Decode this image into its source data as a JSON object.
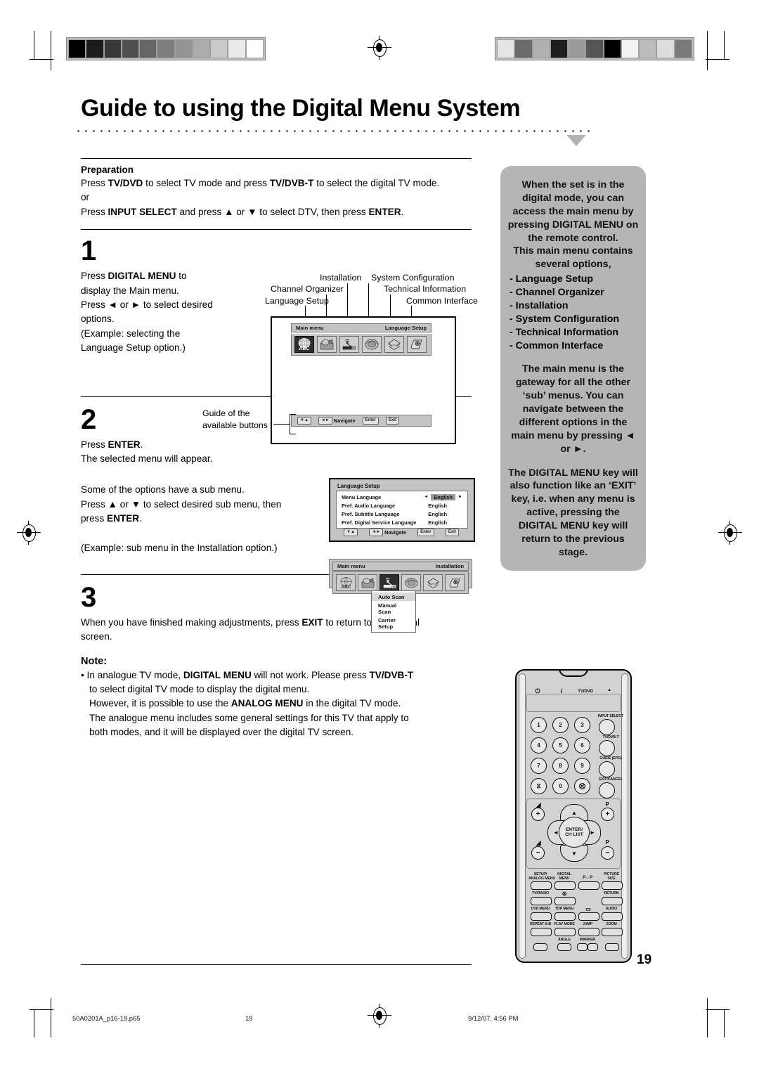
{
  "page": {
    "title": "Guide to using the Digital Menu System",
    "number": "19"
  },
  "preparation": {
    "heading": "Preparation",
    "line1_a": "Press ",
    "line1_b": "TV/DVD",
    "line1_c": " to select TV mode and press ",
    "line1_d": "TV/DVB-T",
    "line1_e": " to select the digital TV mode.",
    "or": "or",
    "line2_a": "Press ",
    "line2_b": "INPUT SELECT",
    "line2_c": " and press ▲ or ▼ to select DTV, then press ",
    "line2_d": "ENTER",
    "line2_e": "."
  },
  "steps": {
    "one": {
      "number": "1",
      "l1_a": "Press ",
      "l1_b": "DIGITAL MENU",
      "l1_c": " to",
      "l2": "display the Main menu.",
      "l3": "Press ◄ or ► to select desired",
      "l4": "options.",
      "l5": "(Example: selecting the",
      "l6": "Language Setup option.)"
    },
    "two": {
      "number": "2",
      "l1_a": "Press ",
      "l1_b": "ENTER",
      "l1_c": ".",
      "l2": "The selected menu will appear.",
      "l3": "Some of the options have a sub menu.",
      "l4_a": "Press ▲ or ▼ to select desired sub menu, then",
      "l4_b": "press ",
      "l4_c": "ENTER",
      "l4_d": ".",
      "l5": "(Example: sub menu in the Installation option.)"
    },
    "three": {
      "number": "3",
      "l1_a": "When you have finished making adjustments, press ",
      "l1_b": "EXIT",
      "l1_c": " to return to the normal",
      "l2": "screen."
    }
  },
  "note": {
    "heading": "Note:",
    "bullet": "•",
    "b1_a": "In analogue TV mode, ",
    "b1_b": "DIGITAL MENU",
    "b1_c": " will not work. Please press ",
    "b1_d": "TV/DVB-T",
    "b2": "to select digital TV mode to display the digital menu.",
    "b3_a": "However, it is possible to use the ",
    "b3_b": "ANALOG MENU",
    "b3_c": " in the digital TV mode.",
    "b4": "The analogue menu includes some general settings for this TV that apply to",
    "b5": "both modes, and it will be displayed over the digital TV screen."
  },
  "callouts": {
    "language_setup": "Language Setup",
    "channel_organizer": "Channel Organizer",
    "installation": "Installation",
    "system_configuration": "System Configuration",
    "technical_information": "Technical Information",
    "common_interface": "Common Interface",
    "guide_line1": "Guide of the",
    "guide_line2": "available buttons"
  },
  "osd_main": {
    "title_left": "Main menu",
    "title_right": "Language Setup",
    "icons": [
      {
        "name": "language-setup-icon",
        "glyph": "AʙC",
        "selected": true
      },
      {
        "name": "channel-organizer-icon",
        "glyph": "",
        "selected": false
      },
      {
        "name": "installation-icon",
        "glyph": "",
        "selected": false
      },
      {
        "name": "system-configuration-icon",
        "glyph": "",
        "selected": false
      },
      {
        "name": "technical-information-icon",
        "glyph": "",
        "selected": false
      },
      {
        "name": "common-interface-icon",
        "glyph": "",
        "selected": false
      }
    ],
    "guide": {
      "updown": "▼▲",
      "leftright": "◄►",
      "navigate": "Navigate",
      "enter": "Enter",
      "exit": "Exit"
    }
  },
  "osd_language": {
    "title": "Language Setup",
    "rows": [
      {
        "label": "Menu Language",
        "value": "English",
        "selected": true
      },
      {
        "label": "Pref. Audio Language",
        "value": "English",
        "selected": false
      },
      {
        "label": "Pref. Subtitle Language",
        "value": "English",
        "selected": false
      },
      {
        "label": "Pref. Digital Service Language",
        "value": "English",
        "selected": false
      }
    ],
    "arrow_left": "◄",
    "arrow_right": "►"
  },
  "osd_installation": {
    "title_left": "Main menu",
    "title_right": "Installation",
    "submenu": [
      "Auto Scan",
      "Manual Scan",
      "Carrier Setup"
    ]
  },
  "panel": {
    "p1": "When the set is in the digital mode, you can access the main menu by pressing DIGITAL MENU on the remote control.",
    "p2": "This main menu contains several options,",
    "bullets": [
      "- Language Setup",
      "- Channel Organizer",
      "- Installation",
      "- System Configuration",
      "- Technical Information",
      "- Common Interface"
    ],
    "p3": "The main menu is the gateway for all the other ‘sub’ menus. You can navigate between the different options in the main menu by pressing ◄ or ►.",
    "p4": "The DIGITAL MENU key will also function like an ‘EXIT’ key, i.e. when any menu is active, pressing the DIGITAL MENU key will return to the previous stage."
  },
  "remote": {
    "power": "⏻",
    "info": "i",
    "tv_dvd": "TV/DVD",
    "eject": "▲",
    "input_select": "INPUT SELECT",
    "tv_dvbt": "TV/DVB-T",
    "guide_epg": "GUIDE (EPG)",
    "exit_cancel": "EXIT/CANCEL",
    "numbers": [
      "1",
      "2",
      "3",
      "4",
      "5",
      "6",
      "7",
      "8",
      "9"
    ],
    "zero": "0",
    "hourglass": "⧖",
    "mute": "⨂",
    "vol_up": "+",
    "vol_down": "−",
    "prog": "P",
    "prog_up": "+",
    "prog_down": "−",
    "enter_l1": "ENTER/",
    "enter_l2": "CH LIST",
    "arrow_up": "▲",
    "arrow_down": "▼",
    "arrow_left": "◄",
    "arrow_right": "►",
    "keys": [
      [
        "SETUP/|ANALOG MENU",
        "DIGITAL|MENU",
        "P↔P",
        "PICTURE|SIZE"
      ],
      [
        "TV/RADIO",
        "⊜",
        "",
        "RETURN"
      ],
      [
        "DVD MENU",
        "TOP MENU",
        "⌨",
        "AUDIO"
      ],
      [
        "REPEAT A-B",
        "PLAY MODE",
        "JUMP",
        "ZOOM"
      ]
    ],
    "bottom_labels": [
      "",
      "ANGLE",
      "MARKER",
      ""
    ]
  },
  "footer": {
    "filename": "50A0201A_p16-19.p65",
    "page": "19",
    "timestamp": "9/12/07, 4:56 PM"
  },
  "colors": {
    "panel_bg": "#b5b5b5",
    "osd_bg": "#c4c4c4",
    "remote_body": "#d2d2d2"
  }
}
